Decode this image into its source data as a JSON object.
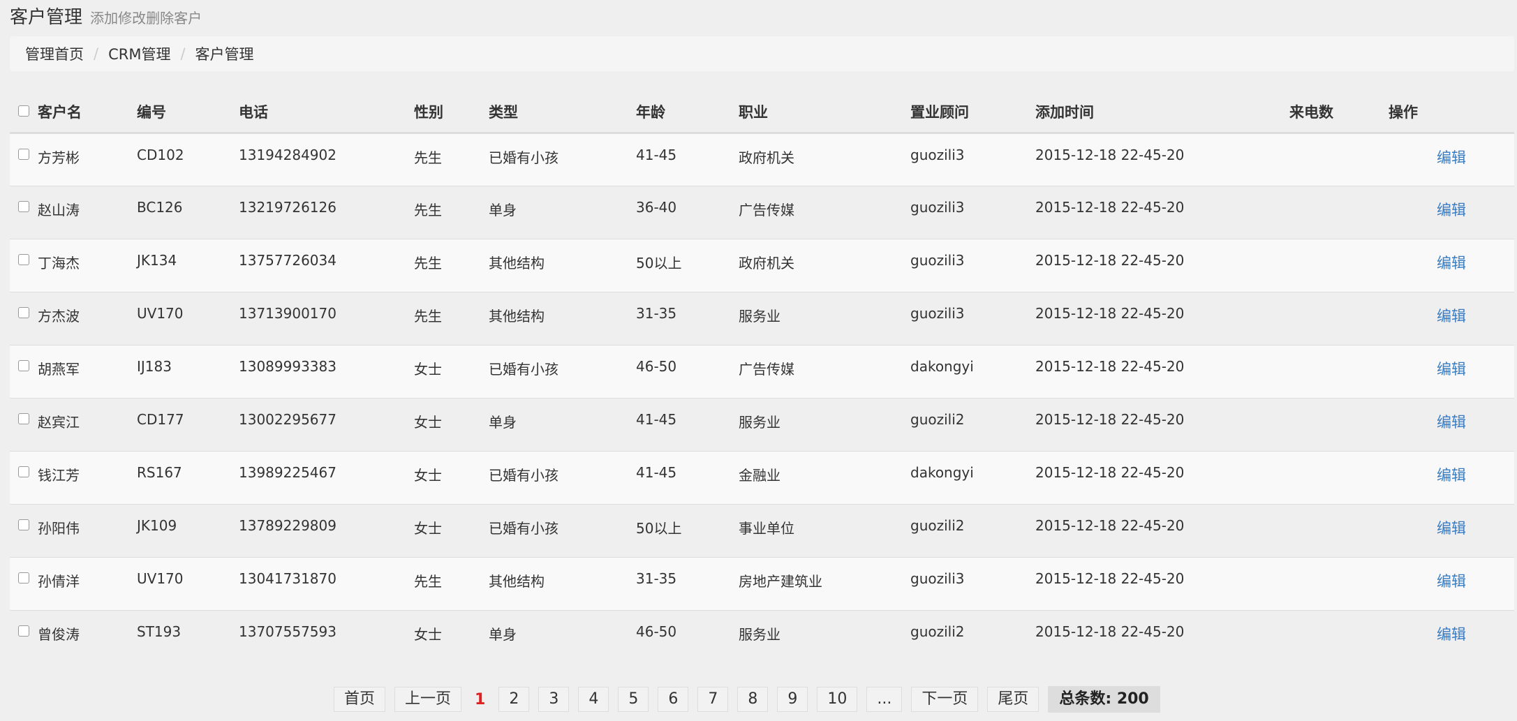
{
  "header": {
    "title": "客户管理",
    "subtitle": "添加修改删除客户"
  },
  "breadcrumb": [
    "管理首页",
    "CRM管理",
    "客户管理"
  ],
  "columns": [
    "客户名",
    "编号",
    "电话",
    "性别",
    "类型",
    "年龄",
    "职业",
    "置业顾问",
    "添加时间",
    "来电数",
    "操作"
  ],
  "rows": [
    {
      "name": "方芳彬",
      "code": "CD102",
      "phone": "13194284902",
      "gender": "先生",
      "type": "已婚有小孩",
      "age": "41-45",
      "job": "政府机关",
      "advisor": "guozili3",
      "time": "2015-12-18 22-45-20",
      "calls": "",
      "action": "编辑"
    },
    {
      "name": "赵山涛",
      "code": "BC126",
      "phone": "13219726126",
      "gender": "先生",
      "type": "单身",
      "age": "36-40",
      "job": "广告传媒",
      "advisor": "guozili3",
      "time": "2015-12-18 22-45-20",
      "calls": "",
      "action": "编辑"
    },
    {
      "name": "丁海杰",
      "code": "JK134",
      "phone": "13757726034",
      "gender": "先生",
      "type": "其他结构",
      "age": "50以上",
      "job": "政府机关",
      "advisor": "guozili3",
      "time": "2015-12-18 22-45-20",
      "calls": "",
      "action": "编辑"
    },
    {
      "name": "方杰波",
      "code": "UV170",
      "phone": "13713900170",
      "gender": "先生",
      "type": "其他结构",
      "age": "31-35",
      "job": "服务业",
      "advisor": "guozili3",
      "time": "2015-12-18 22-45-20",
      "calls": "",
      "action": "编辑"
    },
    {
      "name": "胡燕军",
      "code": "IJ183",
      "phone": "13089993383",
      "gender": "女士",
      "type": "已婚有小孩",
      "age": "46-50",
      "job": "广告传媒",
      "advisor": "dakongyi",
      "time": "2015-12-18 22-45-20",
      "calls": "",
      "action": "编辑"
    },
    {
      "name": "赵宾江",
      "code": "CD177",
      "phone": "13002295677",
      "gender": "女士",
      "type": "单身",
      "age": "41-45",
      "job": "服务业",
      "advisor": "guozili2",
      "time": "2015-12-18 22-45-20",
      "calls": "",
      "action": "编辑"
    },
    {
      "name": "钱江芳",
      "code": "RS167",
      "phone": "13989225467",
      "gender": "女士",
      "type": "已婚有小孩",
      "age": "41-45",
      "job": "金融业",
      "advisor": "dakongyi",
      "time": "2015-12-18 22-45-20",
      "calls": "",
      "action": "编辑"
    },
    {
      "name": "孙阳伟",
      "code": "JK109",
      "phone": "13789229809",
      "gender": "女士",
      "type": "已婚有小孩",
      "age": "50以上",
      "job": "事业单位",
      "advisor": "guozili2",
      "time": "2015-12-18 22-45-20",
      "calls": "",
      "action": "编辑"
    },
    {
      "name": "孙倩洋",
      "code": "UV170",
      "phone": "13041731870",
      "gender": "先生",
      "type": "其他结构",
      "age": "31-35",
      "job": "房地产建筑业",
      "advisor": "guozili3",
      "time": "2015-12-18 22-45-20",
      "calls": "",
      "action": "编辑"
    },
    {
      "name": "曾俊涛",
      "code": "ST193",
      "phone": "13707557593",
      "gender": "女士",
      "type": "单身",
      "age": "46-50",
      "job": "服务业",
      "advisor": "guozili2",
      "time": "2015-12-18 22-45-20",
      "calls": "",
      "action": "编辑"
    }
  ],
  "pager": {
    "first": "首页",
    "prev": "上一页",
    "current": "1",
    "pages": [
      "2",
      "3",
      "4",
      "5",
      "6",
      "7",
      "8",
      "9",
      "10"
    ],
    "ellipsis": "...",
    "next": "下一页",
    "last": "尾页",
    "total": "总条数: 200"
  },
  "colors": {
    "link": "#3a7bbf",
    "current_page": "#e02020"
  }
}
